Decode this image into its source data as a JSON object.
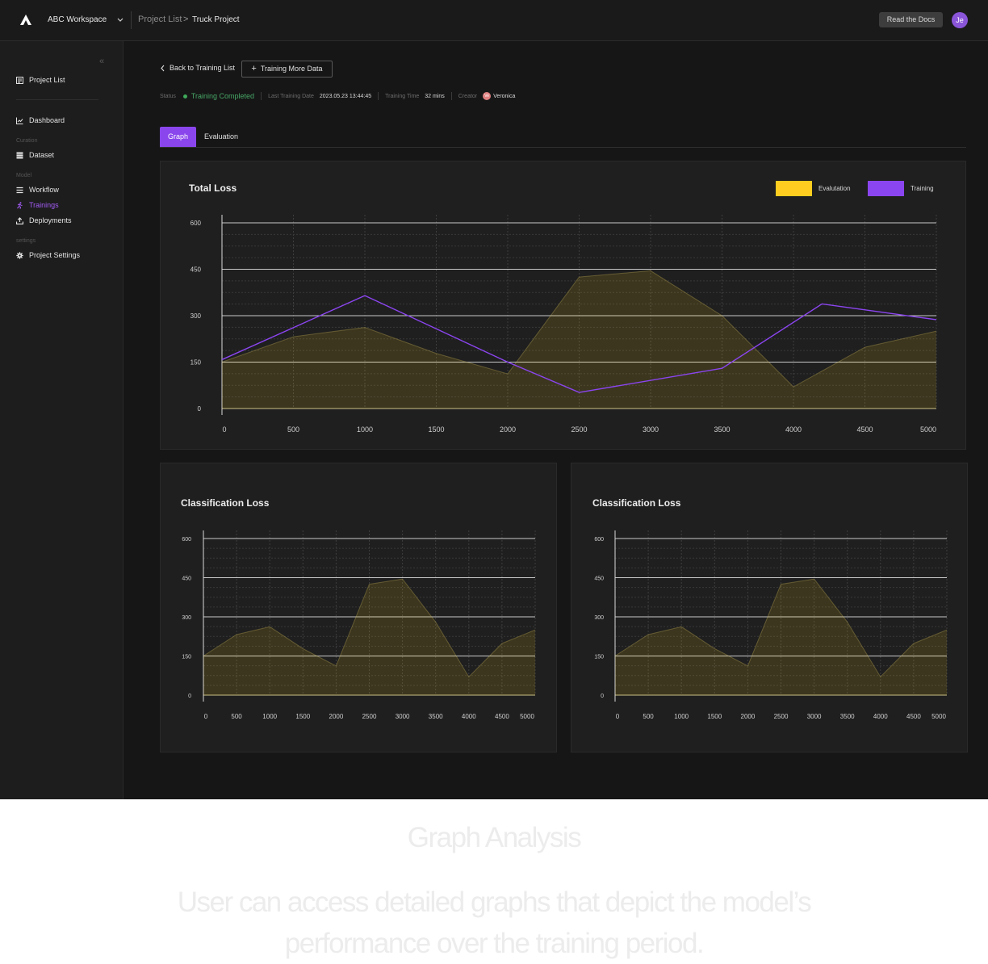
{
  "workspace": {
    "name": "ABC Workspace"
  },
  "breadcrumb": {
    "parent": "Project List",
    "separator": ">",
    "current": "Truck Project"
  },
  "header": {
    "docs_button": "Read the Docs",
    "avatar_initials": "Je"
  },
  "sidebar": {
    "collapse": "«",
    "project_list": "Project List",
    "dashboard": "Dashboard",
    "groups": {
      "curation": "Curation",
      "model": "Model",
      "settings": "settings"
    },
    "dataset": "Dataset",
    "workflow": "Workflow",
    "trainings": "Trainings",
    "deployments": "Deployments",
    "project_settings": "Project Settings",
    "active_item": "Trainings"
  },
  "toolbar": {
    "back_label": "Back to Training List",
    "more_label": "Training More Data"
  },
  "status": {
    "status_label": "Status",
    "status_value": "Training Completed",
    "date_label": "Last Training Date",
    "date_value": "2023.05.23 13:44:45",
    "time_label": "Training Time",
    "time_value": "32 mins",
    "creator_label": "Creator",
    "creator_initials": "Ve",
    "creator_name": "Veronica"
  },
  "tabs": {
    "graph": "Graph",
    "evaluation": "Evaluation"
  },
  "colors": {
    "accent": "#8a46ec",
    "evaluation": "#ffcd1f",
    "training": "#8b45f0",
    "success": "#47a766"
  },
  "chart_data": [
    {
      "type": "line",
      "title": "Total Loss",
      "legend": [
        "Evalutation",
        "Training"
      ],
      "legend_position": "top-right",
      "xlim": [
        0,
        5000
      ],
      "ylim": [
        0,
        600
      ],
      "x_ticks": [
        0,
        500,
        1000,
        1500,
        2000,
        2500,
        3000,
        3500,
        4000,
        4500,
        5000
      ],
      "y_ticks": [
        0,
        150,
        300,
        450,
        600
      ],
      "series": [
        {
          "name": "Evalutation",
          "style": "area",
          "x": [
            0,
            500,
            1000,
            1500,
            2000,
            2500,
            3000,
            3500,
            4000,
            4500,
            5000
          ],
          "y": [
            150,
            232,
            262,
            178,
            112,
            425,
            445,
            300,
            70,
            198,
            250
          ]
        },
        {
          "name": "Training",
          "style": "line",
          "x": [
            0,
            1000,
            2000,
            2500,
            3500,
            4200,
            5000
          ],
          "y": [
            158,
            365,
            150,
            52,
            130,
            338,
            287
          ]
        }
      ]
    },
    {
      "type": "area",
      "title": "Classification Loss",
      "xlim": [
        0,
        5000
      ],
      "ylim": [
        0,
        600
      ],
      "x_ticks": [
        0,
        500,
        1000,
        1500,
        2000,
        2500,
        3000,
        3500,
        4000,
        4500,
        5000
      ],
      "y_ticks": [
        0,
        150,
        300,
        450,
        600
      ],
      "series": [
        {
          "x": [
            0,
            500,
            1000,
            1500,
            2000,
            2500,
            3000,
            3500,
            4000,
            4500,
            5000
          ],
          "y": [
            150,
            232,
            262,
            178,
            112,
            425,
            445,
            280,
            70,
            198,
            250
          ]
        }
      ]
    },
    {
      "type": "area",
      "title": "Classification Loss",
      "xlim": [
        0,
        5000
      ],
      "ylim": [
        0,
        600
      ],
      "x_ticks": [
        0,
        500,
        1000,
        1500,
        2000,
        2500,
        3000,
        3500,
        4000,
        4500,
        5000
      ],
      "y_ticks": [
        0,
        150,
        300,
        450,
        600
      ],
      "series": [
        {
          "x": [
            0,
            500,
            1000,
            1500,
            2000,
            2500,
            3000,
            3500,
            4000,
            4500,
            5000
          ],
          "y": [
            150,
            232,
            262,
            178,
            112,
            425,
            445,
            280,
            70,
            198,
            250
          ]
        }
      ]
    }
  ],
  "promo": {
    "title": "Graph Analysis",
    "line1": "User can access detailed graphs that depict the model’s",
    "line2": "performance over the training period."
  }
}
